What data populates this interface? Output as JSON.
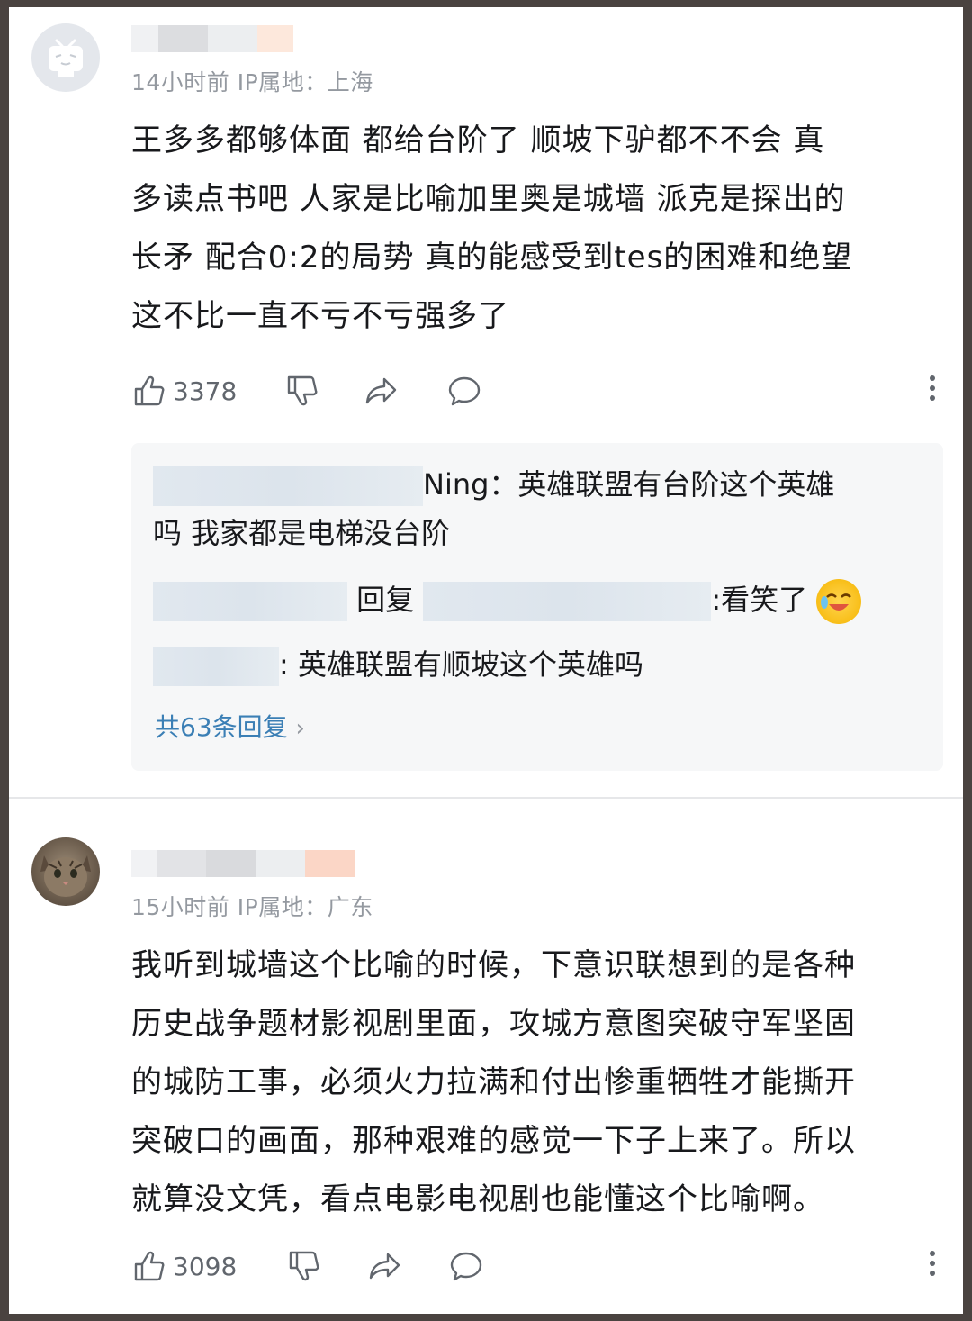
{
  "comments": [
    {
      "meta": "14小时前  IP属地：上海",
      "lines": [
        "王多多都够体面  都给台阶了  顺坡下驴都不不会  真",
        "多读点书吧  人家是比喻加里奥是城墙  派克是探出的",
        "长矛  配合0:2的局势  真的能感受到tes的困难和绝望",
        "这不比一直不亏不亏强多了"
      ],
      "likes": "3378",
      "replies": {
        "r1_suffix": "Ning：英雄联盟有台阶这个英雄",
        "r1_line2": "吗 我家都是电梯没台阶",
        "r2_mid": "回复",
        "r2_suffix": ":看笑了",
        "r3_suffix": ": 英雄联盟有顺坡这个英雄吗",
        "total": "共63条回复"
      }
    },
    {
      "meta": "15小时前  IP属地：广东",
      "lines": [
        "我听到城墙这个比喻的时候，下意识联想到的是各种",
        "历史战争题材影视剧里面，攻城方意图突破守军坚固",
        "的城防工事，必须火力拉满和付出惨重牺牲才能撕开",
        "突破口的画面，那种艰难的感觉一下子上来了。所以",
        "就算没文凭，看点电影电视剧也能懂这个比喻啊。"
      ],
      "likes": "3098"
    }
  ],
  "icons": {
    "like": "thumbs-up-icon",
    "dislike": "thumbs-down-icon",
    "share": "share-icon",
    "reply": "comment-icon",
    "more": "more-vertical-icon"
  },
  "colors": {
    "link": "#3b7fb5",
    "meta": "#9499a0",
    "text": "#18191c"
  }
}
